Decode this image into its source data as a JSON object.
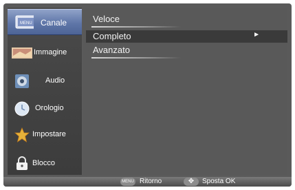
{
  "sidebar": {
    "items": [
      {
        "label": "Canale",
        "icon": "channel-icon"
      },
      {
        "label": "Immagine",
        "icon": "picture-icon"
      },
      {
        "label": "Audio",
        "icon": "speaker-icon"
      },
      {
        "label": "Orologio",
        "icon": "clock-icon"
      },
      {
        "label": "Impostare",
        "icon": "star-icon"
      },
      {
        "label": "Blocco",
        "icon": "lock-icon"
      }
    ]
  },
  "menu": {
    "items": [
      {
        "label": "Veloce"
      },
      {
        "label": "Completo",
        "arrow": "►"
      },
      {
        "label": "Avanzato"
      }
    ]
  },
  "footer": {
    "back_key": "MENU",
    "back_label": "Ritorno",
    "move_key": "✥",
    "move_label": "Sposta OK"
  },
  "colors": {
    "selection": "#5f76a8",
    "panel": "#595959"
  }
}
